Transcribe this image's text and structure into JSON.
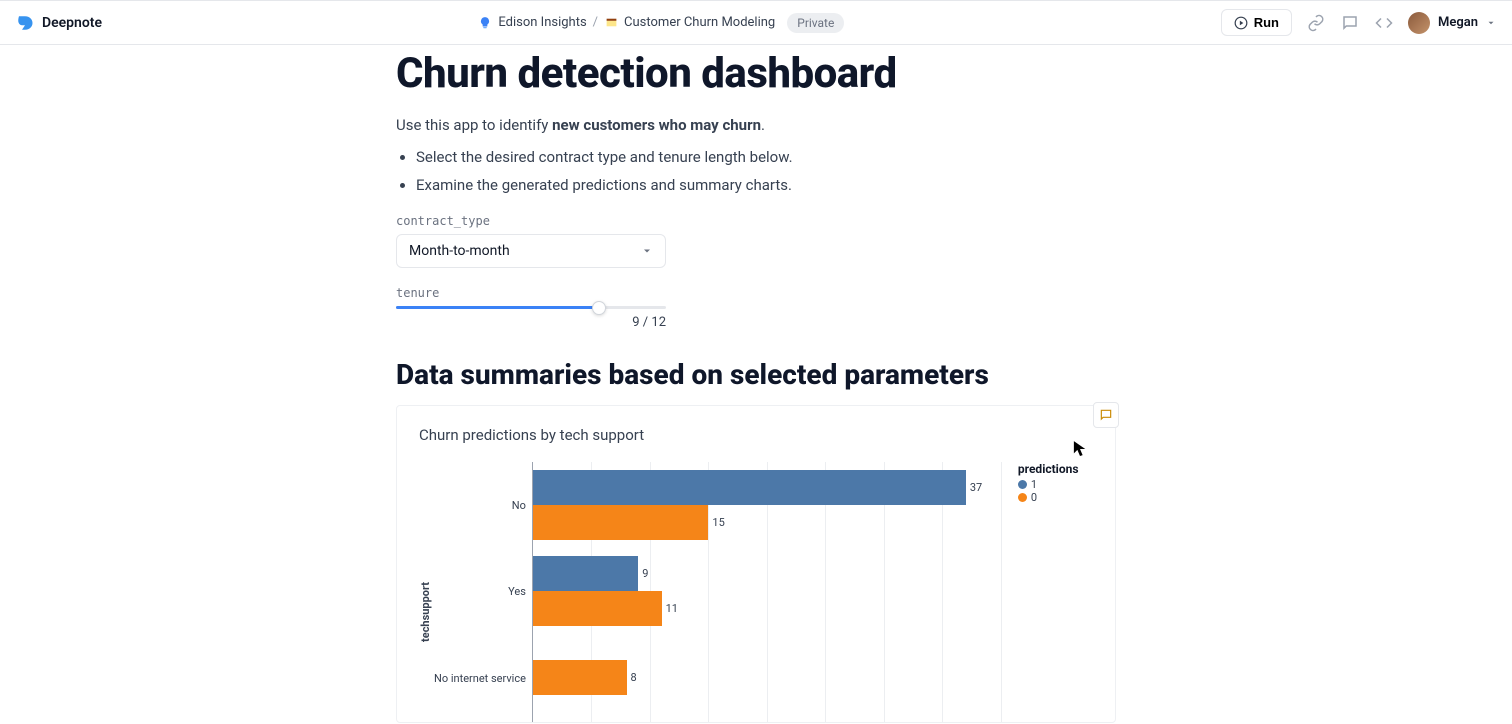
{
  "brand": "Deepnote",
  "breadcrumb": {
    "workspace": "Edison Insights",
    "notebook": "Customer Churn Modeling",
    "badge": "Private"
  },
  "topbar": {
    "run_label": "Run",
    "user_name": "Megan"
  },
  "page": {
    "title": "Churn detection dashboard",
    "intro_prefix": "Use this app to identify ",
    "intro_bold": "new customers who may churn",
    "intro_suffix": ".",
    "bullets": [
      "Select the desired contract type and tenure length below.",
      "Examine the generated predictions and summary charts."
    ]
  },
  "controls": {
    "contract_label": "contract_type",
    "contract_value": "Month-to-month",
    "tenure_label": "tenure",
    "tenure_value": 9,
    "tenure_max": 12,
    "tenure_readout": "9 / 12"
  },
  "section_heading": "Data summaries based on selected parameters",
  "chart_data": {
    "type": "bar",
    "title": "Churn predictions by tech support",
    "ylabel": "techsupport",
    "legend_title": "predictions",
    "categories": [
      "No",
      "Yes",
      "No internet service"
    ],
    "xlim": [
      0,
      40
    ],
    "series": [
      {
        "name": "1",
        "color": "#4c78a8",
        "values": [
          37,
          9,
          0
        ]
      },
      {
        "name": "0",
        "color": "#f58518",
        "values": [
          15,
          11,
          8
        ]
      }
    ]
  }
}
